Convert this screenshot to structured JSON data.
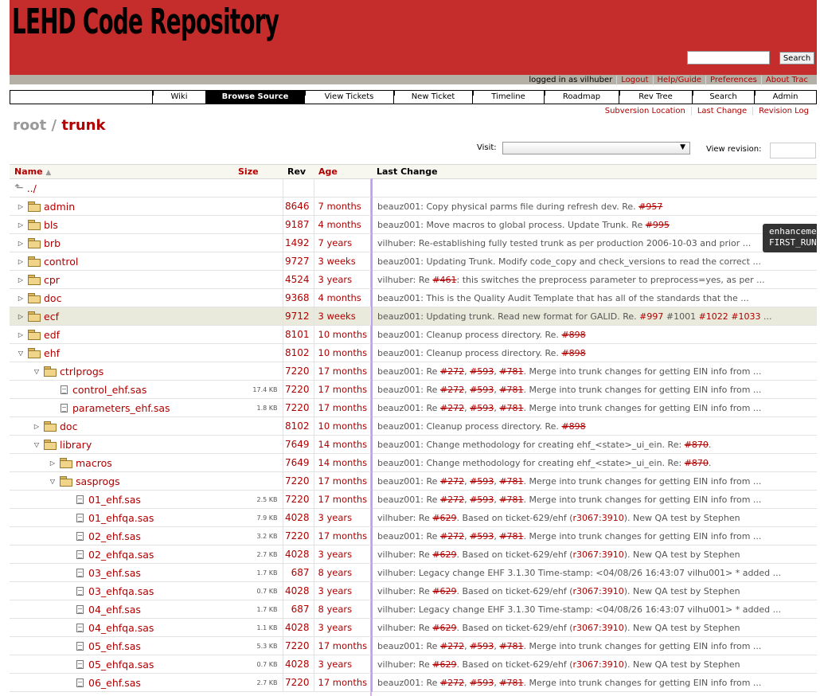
{
  "header": {
    "logo_text": "LEHD Code Repository",
    "search_button": "Search",
    "search_value": ""
  },
  "metanav": {
    "logged_in": "logged in as vilhuber",
    "logout": "Logout",
    "help": "Help/Guide",
    "preferences": "Preferences",
    "about": "About Trac"
  },
  "mainnav": {
    "wiki": "Wiki",
    "browse": "Browse Source",
    "view_tickets": "View Tickets",
    "new_ticket": "New Ticket",
    "timeline": "Timeline",
    "roadmap": "Roadmap",
    "rev_tree": "Rev Tree",
    "search": "Search",
    "admin": "Admin"
  },
  "ctxtnav": {
    "svn_location": "Subversion Location",
    "last_change": "Last Change",
    "revision_log": "Revision Log"
  },
  "path": {
    "root": "root",
    "sep": "/",
    "trunk": "trunk"
  },
  "controls": {
    "visit_label": "Visit:",
    "view_revision_label": "View revision:",
    "visit_value": "",
    "revision_value": ""
  },
  "table": {
    "headers": {
      "name": "Name",
      "size": "Size",
      "rev": "Rev",
      "age": "Age",
      "last_change": "Last Change"
    },
    "parent_link": "../",
    "rows": [
      {
        "name": "admin",
        "size": "",
        "rev": "8646",
        "age": "7 months",
        "author": "beauz001:",
        "msg": " Copy physical parms file during refresh dev. Re. ",
        "t": [
          "#957"
        ],
        "tail": ""
      },
      {
        "name": "bls",
        "size": "",
        "rev": "9187",
        "age": "4 months",
        "author": "beauz001:",
        "msg": " Move macros to global process. Update Trunk. Re ",
        "t": [
          "#995"
        ],
        "tail": ""
      },
      {
        "name": "brb",
        "size": "",
        "rev": "1492",
        "age": "7 years",
        "author": "vilhuber:",
        "msg": " Re-establishing fully tested trunk as per production 2006-10-03 and prior ...",
        "t": [],
        "tail": ""
      },
      {
        "name": "control",
        "size": "",
        "rev": "9727",
        "age": "3 weeks",
        "author": "beauz001:",
        "msg": " Updating Trunk. Modify code_copy and check_versions to read the correct ...",
        "t": [],
        "tail": ""
      },
      {
        "name": "cpr",
        "size": "",
        "rev": "4524",
        "age": "3 years",
        "author": "vilhuber:",
        "msg": " Re ",
        "t": [
          "#461"
        ],
        "tail": ": this switches the preprocess parameter to preprocess=yes, as per ..."
      },
      {
        "name": "doc",
        "size": "",
        "rev": "9368",
        "age": "4 months",
        "author": "beauz001:",
        "msg": " This is the Quality Audit Template that has all of the standards that the ...",
        "t": [],
        "tail": ""
      },
      {
        "name": "ecf",
        "size": "",
        "rev": "9712",
        "age": "3 weeks",
        "author": "beauz001:",
        "msg": " Updating trunk. Read new format for GALID. Re. ",
        "t": [],
        "tail": ""
      },
      {
        "name": "edf",
        "size": "",
        "rev": "8101",
        "age": "10 months",
        "author": "beauz001:",
        "msg": " Cleanup process directory. Re. ",
        "t": [
          "#898"
        ],
        "tail": ""
      },
      {
        "name": "ehf",
        "size": "",
        "rev": "8102",
        "age": "10 months",
        "author": "beauz001:",
        "msg": " Cleanup process directory. Re. ",
        "t": [
          "#898"
        ],
        "tail": ""
      },
      {
        "name": "ctrlprogs",
        "size": "",
        "rev": "7220",
        "age": "17 months",
        "author": "beauz001:",
        "msg": " Re ",
        "t": [
          "#272",
          "#593",
          "#781"
        ],
        "tail": ". Merge into trunk changes for getting EIN info from ..."
      },
      {
        "name": "control_ehf.sas",
        "size": "17.4 KB",
        "rev": "7220",
        "age": "17 months",
        "author": "beauz001:",
        "msg": " Re ",
        "t": [
          "#272",
          "#593",
          "#781"
        ],
        "tail": ". Merge into trunk changes for getting EIN info from ..."
      },
      {
        "name": "parameters_ehf.sas",
        "size": "1.8 KB",
        "rev": "7220",
        "age": "17 months",
        "author": "beauz001:",
        "msg": " Re ",
        "t": [
          "#272",
          "#593",
          "#781"
        ],
        "tail": ". Merge into trunk changes for getting EIN info from ..."
      },
      {
        "name": "doc",
        "size": "",
        "rev": "8102",
        "age": "10 months",
        "author": "beauz001:",
        "msg": " Cleanup process directory. Re. ",
        "t": [
          "#898"
        ],
        "tail": ""
      },
      {
        "name": "library",
        "size": "",
        "rev": "7649",
        "age": "14 months",
        "author": "beauz001:",
        "msg": " Change methodology for creating ehf_<state>_ui_ein. Re: ",
        "t": [
          "#870"
        ],
        "tail": "."
      },
      {
        "name": "macros",
        "size": "",
        "rev": "7649",
        "age": "14 months",
        "author": "beauz001:",
        "msg": " Change methodology for creating ehf_<state>_ui_ein. Re: ",
        "t": [
          "#870"
        ],
        "tail": "."
      },
      {
        "name": "sasprogs",
        "size": "",
        "rev": "7220",
        "age": "17 months",
        "author": "beauz001:",
        "msg": " Re ",
        "t": [
          "#272",
          "#593",
          "#781"
        ],
        "tail": ". Merge into trunk changes for getting EIN info from ..."
      },
      {
        "name": "01_ehf.sas",
        "size": "2.5 KB",
        "rev": "7220",
        "age": "17 months",
        "author": "beauz001:",
        "msg": " Re ",
        "t": [
          "#272",
          "#593",
          "#781"
        ],
        "tail": ". Merge into trunk changes for getting EIN info from ..."
      },
      {
        "name": "01_ehfqa.sas",
        "size": "7.9 KB",
        "rev": "4028",
        "age": "3 years",
        "author": "vilhuber:",
        "msg": " Re ",
        "t": [
          "#629"
        ],
        "tail": ". Based on ticket-629/ehf (",
        "r": "r3067:3910",
        "tail2": "). New QA test by Stephen"
      },
      {
        "name": "02_ehf.sas",
        "size": "3.2 KB",
        "rev": "7220",
        "age": "17 months",
        "author": "beauz001:",
        "msg": " Re ",
        "t": [
          "#272",
          "#593",
          "#781"
        ],
        "tail": ". Merge into trunk changes for getting EIN info from ..."
      },
      {
        "name": "02_ehfqa.sas",
        "size": "2.7 KB",
        "rev": "4028",
        "age": "3 years",
        "author": "vilhuber:",
        "msg": " Re ",
        "t": [
          "#629"
        ],
        "tail": ". Based on ticket-629/ehf (",
        "r": "r3067:3910",
        "tail2": "). New QA test by Stephen"
      },
      {
        "name": "03_ehf.sas",
        "size": "1.7 KB",
        "rev": "687",
        "age": "8 years",
        "author": "vilhuber:",
        "msg": " Legacy change EHF 3.1.30 Time-stamp: <04/08/26 16:43:07 vilhu001> * added ...",
        "t": [],
        "tail": ""
      },
      {
        "name": "03_ehfqa.sas",
        "size": "0.7 KB",
        "rev": "4028",
        "age": "3 years",
        "author": "vilhuber:",
        "msg": " Re ",
        "t": [
          "#629"
        ],
        "tail": ". Based on ticket-629/ehf (",
        "r": "r3067:3910",
        "tail2": "). New QA test by Stephen"
      },
      {
        "name": "04_ehf.sas",
        "size": "1.7 KB",
        "rev": "687",
        "age": "8 years",
        "author": "vilhuber:",
        "msg": " Legacy change EHF 3.1.30 Time-stamp: <04/08/26 16:43:07 vilhu001> * added ...",
        "t": [],
        "tail": ""
      },
      {
        "name": "04_ehfqa.sas",
        "size": "1.1 KB",
        "rev": "4028",
        "age": "3 years",
        "author": "vilhuber:",
        "msg": " Re ",
        "t": [
          "#629"
        ],
        "tail": ". Based on ticket-629/ehf (",
        "r": "r3067:3910",
        "tail2": "). New QA test by Stephen"
      },
      {
        "name": "05_ehf.sas",
        "size": "5.3 KB",
        "rev": "7220",
        "age": "17 months",
        "author": "beauz001:",
        "msg": " Re ",
        "t": [
          "#272",
          "#593",
          "#781"
        ],
        "tail": ". Merge into trunk changes for getting EIN info from ..."
      },
      {
        "name": "05_ehfqa.sas",
        "size": "0.7 KB",
        "rev": "4028",
        "age": "3 years",
        "author": "vilhuber:",
        "msg": " Re ",
        "t": [
          "#629"
        ],
        "tail": ". Based on ticket-629/ehf (",
        "r": "r3067:3910",
        "tail2": "). New QA test by Stephen"
      },
      {
        "name": "06_ehf.sas",
        "size": "2.7 KB",
        "rev": "7220",
        "age": "17 months",
        "author": "beauz001:",
        "msg": " Re ",
        "t": [
          "#272",
          "#593",
          "#781"
        ],
        "tail": ". Merge into trunk changes for getting EIN info from ..."
      }
    ],
    "ecf_tickets": [
      "#997",
      "#1001",
      "#1022",
      "#1033"
    ],
    "ecf_tail": " ..."
  },
  "tooltip": {
    "line1": "enhanceme",
    "line2": "FIRST_RUN"
  }
}
